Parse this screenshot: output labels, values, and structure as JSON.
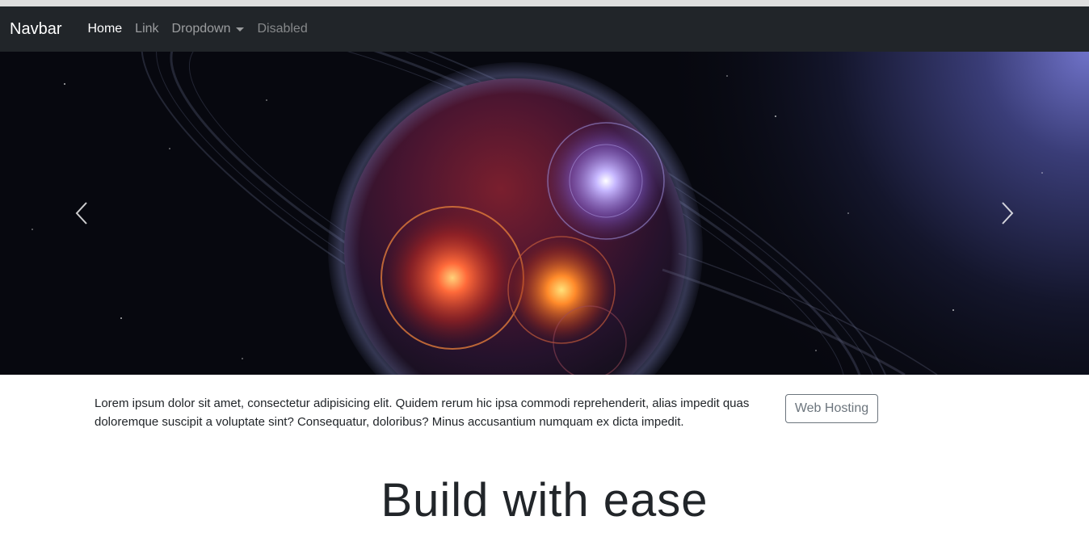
{
  "navbar": {
    "brand": "Navbar",
    "links": [
      {
        "label": "Home"
      },
      {
        "label": "Link"
      },
      {
        "label": "Dropdown"
      },
      {
        "label": "Disabled"
      }
    ]
  },
  "carousel": {
    "image": "space-planet-with-rings",
    "prev_icon": "chevron-left-icon",
    "next_icon": "chevron-right-icon"
  },
  "content": {
    "paragraph": "Lorem ipsum dolor sit amet, consectetur adipisicing elit. Quidem rerum hic ipsa commodi reprehenderit, alias impedit quas doloremque suscipit a voluptate sint? Consequatur, doloribus? Minus accusantium numquam ex dicta impedit.",
    "button_label": "Web Hosting"
  },
  "hero": {
    "heading": "Build with ease"
  },
  "colors": {
    "navbar_bg": "#212529",
    "button_border": "#6c757d"
  }
}
